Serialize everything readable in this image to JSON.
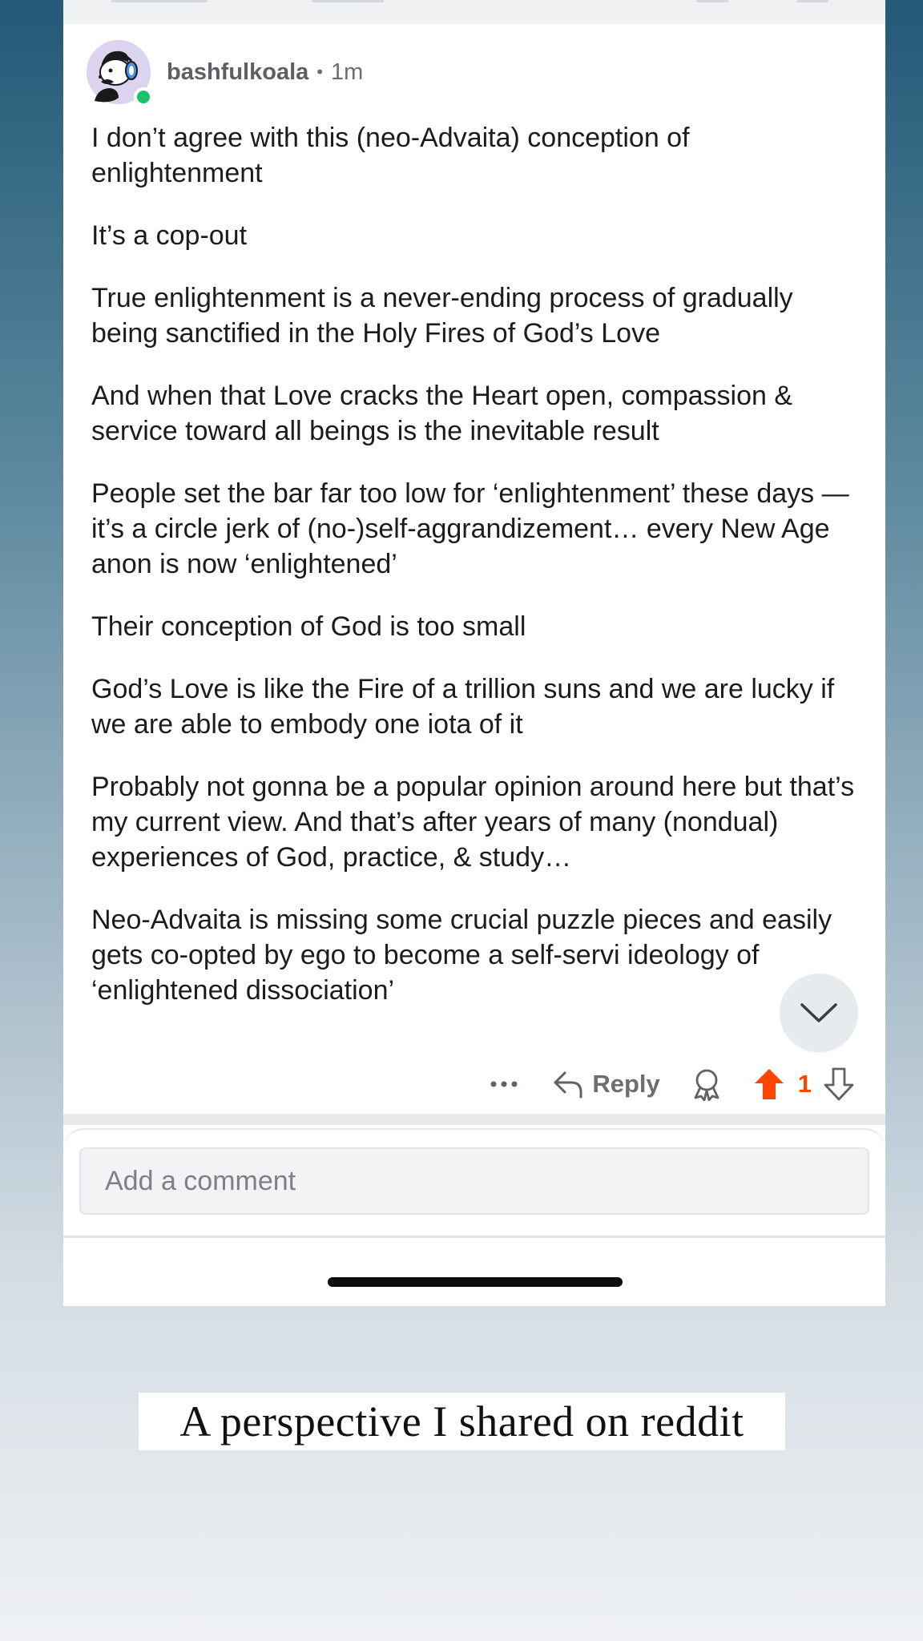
{
  "comment": {
    "username": "bashfulkoala",
    "separator": "•",
    "age": "1m",
    "avatar_icon": "snoo-headphones-avatar",
    "online_status_color": "#19c26b",
    "paragraphs": [
      "I don’t agree with this (neo-Advaita) conception of enlightenment",
      "It’s a cop-out",
      "True enlightenment is a never-ending process of gradually being sanctified in the Holy Fires of God’s Love",
      "And when that Love cracks the Heart open, compassion & service toward all beings is the inevitable result",
      "People set the bar far too low for ‘enlightenment’ these days — it’s a circle jerk of (no-)self-aggrandizement… every New Age anon is now ‘enlightened’",
      "Their conception of God is too small",
      "God’s Love is like the Fire of a trillion suns and we are lucky if we are able to embody one iota of it",
      "Probably not gonna be a popular opinion around here but that’s my current view. And that’s after years of many (nondual) experiences of God, practice, & study…",
      "Neo-Advaita is missing some crucial puzzle pieces and easily gets co-opted by ego to become a self-servi ideology of ‘enlightened dissociation’"
    ],
    "actions": {
      "more_icon": "more-dots-icon",
      "reply_label": "Reply",
      "award_icon": "award-icon",
      "vote_count": "1",
      "upvote_color": "#ff4500"
    }
  },
  "composer": {
    "placeholder": "Add a comment"
  },
  "caption": "A perspective I shared on reddit"
}
